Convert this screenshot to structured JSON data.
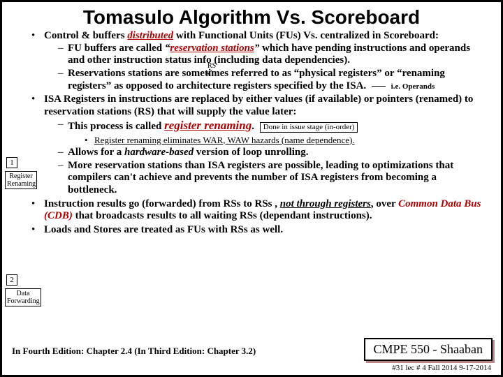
{
  "title": "Tomasulo Algorithm Vs. Scoreboard",
  "sidebox1_num": "1",
  "sidebox1_label": "Register\nRenaming",
  "sidebox2_num": "2",
  "sidebox2_label": "Data\nForwarding",
  "rs_label": "RS",
  "ie_label": "i.e. Operands",
  "b1_lead": "Control & buffers ",
  "b1_dist": "distributed",
  "b1_rest": " with Functional Units (FUs) Vs.  centralized in Scoreboard:",
  "b1s1_a": "FU buffers are called ",
  "b1s1_q1": "“",
  "b1s1_rs": "reservation stations",
  "b1s1_q2": "”",
  "b1s1_b": " which have pending instructions and operands and other instruction status info (including data dependencies).",
  "b1s2": "Reservations stations are sometimes referred  to as “physical registers”  or “renaming registers”  as opposed to architecture registers specified by the ISA.",
  "b2": "ISA Registers in instructions are replaced by either values (if available) or pointers (renamed) to reservation stations (RS) that will supply the value later:",
  "b2s1_a": "This process is called ",
  "b2s1_b": "register renaming",
  "b2s1_dot": ".",
  "b2s1_box": "Done in issue stage (in-order)",
  "b2ss1": "Register renaming eliminates WAR, WAW hazards (name dependence).",
  "b2s2_a": "Allows for a ",
  "b2s2_b": "hardware-based",
  "b2s2_c": " version of loop unrolling.",
  "b2s3": "More reservation stations than ISA registers are possible,  leading to optimizations that compilers can't achieve and prevents the number of ISA registers from becoming a bottleneck.",
  "b3_a": "Instruction results go (forwarded) from RSs to RSs , ",
  "b3_b": "not through registers",
  "b3_c": ", over ",
  "b3_d": "Common Data Bus (CDB)",
  "b3_e": " that broadcasts results to all waiting RSs (dependant instructions).",
  "b4": "Loads and Stores are treated as FUs with RSs as well.",
  "footer_left": "In Fourth Edition: Chapter 2.4 (In Third Edition: Chapter 3.2)",
  "footer_box": "CMPE 550 - Shaaban",
  "footer_line": "#31  lec # 4 Fall 2014   9-17-2014"
}
